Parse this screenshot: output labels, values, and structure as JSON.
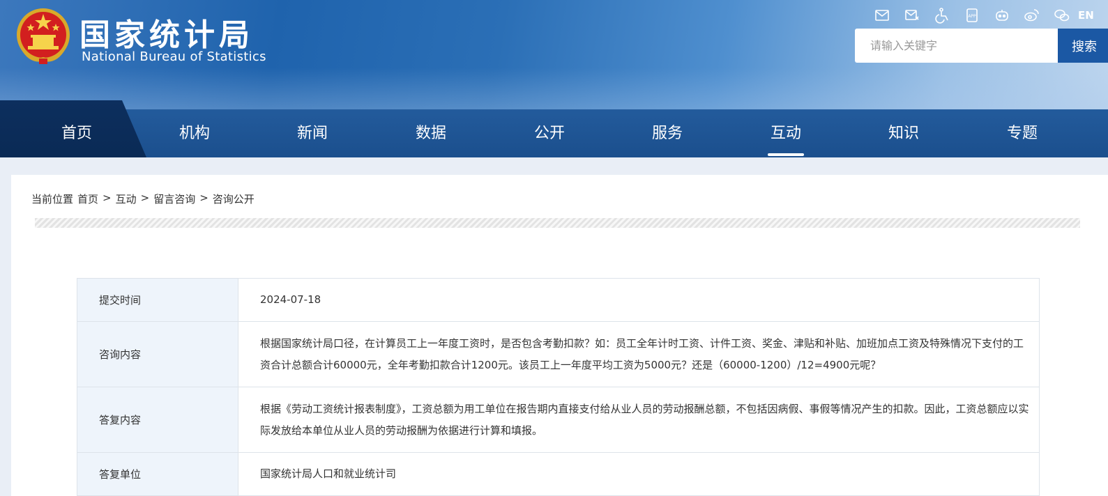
{
  "header": {
    "title_cn": "国家统计局",
    "title_en": "National Bureau of Statistics",
    "icons": [
      "mail-icon",
      "mail-send-icon",
      "accessibility-icon",
      "app-icon",
      "robot-icon",
      "weibo-icon",
      "wechat-icon"
    ],
    "lang_label": "EN",
    "search_placeholder": "请输入关键字",
    "search_button": "搜索"
  },
  "nav": {
    "items": [
      "首页",
      "机构",
      "新闻",
      "数据",
      "公开",
      "服务",
      "互动",
      "知识",
      "专题"
    ],
    "active_index": 6
  },
  "breadcrumb": {
    "prefix": "当前位置",
    "items": [
      "首页",
      "互动",
      "留言咨询",
      "咨询公开"
    ],
    "separator": ">"
  },
  "consultation": {
    "submit_time_label": "提交时间",
    "submit_time": "2024-07-18",
    "question_label": "咨询内容",
    "question": "根据国家统计局口径，在计算员工上一年度工资时，是否包含考勤扣款？如：员工全年计时工资、计件工资、奖金、津贴和补贴、加班加点工资及特殊情况下支付的工资合计总额合计60000元，全年考勤扣款合计1200元。该员工上一年度平均工资为5000元？还是（60000-1200）/12=4900元呢？",
    "answer_label": "答复内容",
    "answer": "根据《劳动工资统计报表制度》，工资总额为用工单位在报告期内直接支付给从业人员的劳动报酬总额，不包括因病假、事假等情况产生的扣款。因此，工资总额应以实际发放给本单位从业人员的劳动报酬为依据进行计算和填报。",
    "unit_label": "答复单位",
    "unit": "国家统计局人口和就业统计司"
  },
  "colors": {
    "nav_bg": "#1b4f8d",
    "home_tab_bg": "#0a2a55",
    "search_button": "#1b58a4",
    "label_cell_bg": "#eef4fb"
  }
}
